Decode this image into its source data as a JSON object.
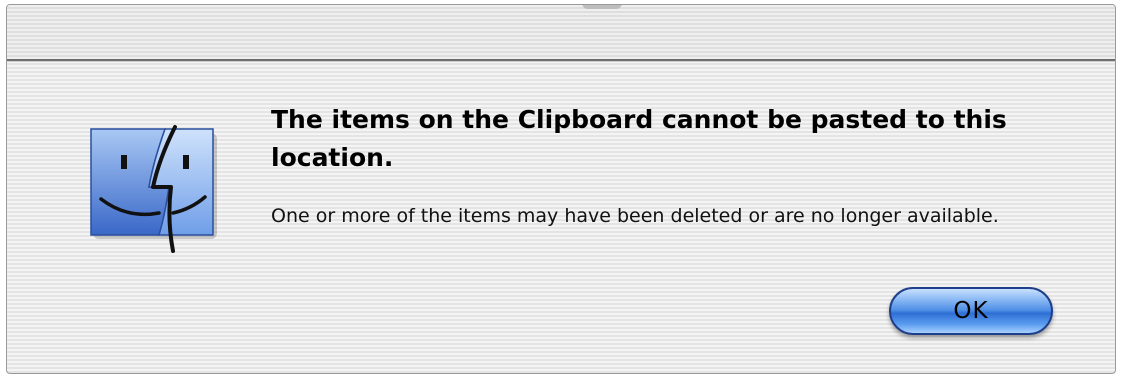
{
  "dialog": {
    "icon": "finder-icon",
    "headline": "The items on the Clipboard cannot be pasted to this location.",
    "message": "One or more of the items may have been deleted or are no longer available.",
    "ok_label": "OK",
    "accent_color": "#3d7fe0"
  }
}
